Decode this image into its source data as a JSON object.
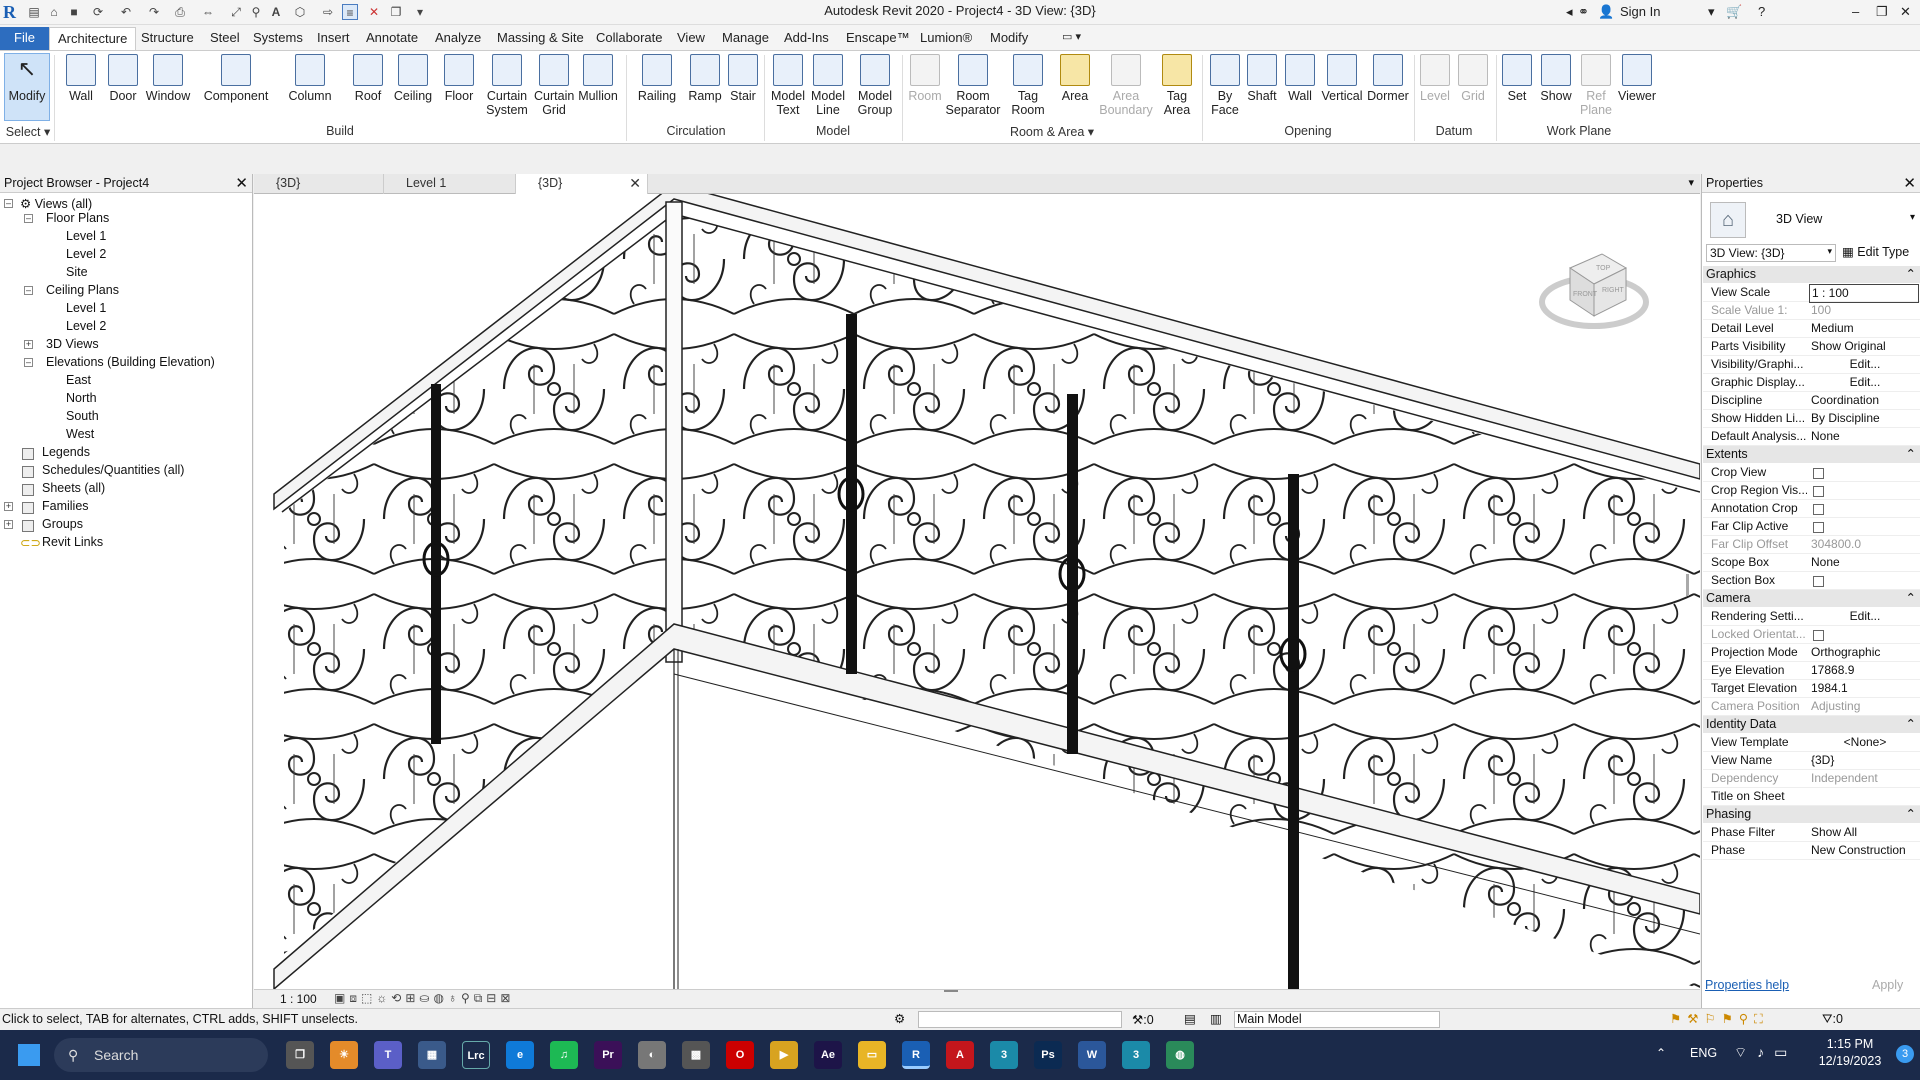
{
  "app": {
    "title": "Autodesk Revit 2020 - Project4 - 3D View: {3D}",
    "sign_in": "Sign In"
  },
  "ribbon_tabs": [
    "File",
    "Architecture",
    "Structure",
    "Steel",
    "Systems",
    "Insert",
    "Annotate",
    "Analyze",
    "Massing & Site",
    "Collaborate",
    "View",
    "Manage",
    "Add-Ins",
    "Enscape™",
    "Lumion®",
    "Modify"
  ],
  "ribbon": {
    "select_label": "Select",
    "modify": "Modify",
    "build": {
      "label": "Build",
      "buttons": [
        "Wall",
        "Door",
        "Window",
        "Component",
        "Column",
        "Roof",
        "Ceiling",
        "Floor",
        "Curtain System",
        "Curtain Grid",
        "Mullion"
      ]
    },
    "circulation": {
      "label": "Circulation",
      "buttons": [
        "Railing",
        "Ramp",
        "Stair"
      ]
    },
    "model": {
      "label": "Model",
      "buttons": [
        "Model Text",
        "Model Line",
        "Model Group"
      ]
    },
    "room_area": {
      "label": "Room & Area",
      "buttons": [
        "Room",
        "Room Separator",
        "Tag Room",
        "Area",
        "Area Boundary",
        "Tag Area"
      ]
    },
    "opening": {
      "label": "Opening",
      "buttons": [
        "By Face",
        "Shaft",
        "Wall",
        "Vertical",
        "Dormer"
      ]
    },
    "datum": {
      "label": "Datum",
      "buttons": [
        "Level",
        "Grid"
      ]
    },
    "work_plane": {
      "label": "Work Plane",
      "buttons": [
        "Set",
        "Show",
        "Ref Plane",
        "Viewer"
      ]
    }
  },
  "project_browser": {
    "title": "Project Browser - Project4",
    "tree": {
      "views": "Views (all)",
      "floor_plans": "Floor Plans",
      "fp_level1": "Level 1",
      "fp_level2": "Level 2",
      "fp_site": "Site",
      "ceiling_plans": "Ceiling Plans",
      "cp_level1": "Level 1",
      "cp_level2": "Level 2",
      "views_3d": "3D Views",
      "elevations": "Elevations (Building Elevation)",
      "east": "East",
      "north": "North",
      "south": "South",
      "west": "West",
      "legends": "Legends",
      "schedules": "Schedules/Quantities (all)",
      "sheets": "Sheets (all)",
      "families": "Families",
      "groups": "Groups",
      "revit_links": "Revit Links"
    }
  },
  "view_tabs": [
    "{3D}",
    "Level 1",
    "{3D}"
  ],
  "view_control": {
    "scale": "1 : 100"
  },
  "viewcube": {
    "top": "TOP",
    "front": "FRONT",
    "right": "RIGHT"
  },
  "properties": {
    "title": "Properties",
    "type_name": "3D View",
    "selector": "3D View: {3D}",
    "edit_type": "Edit Type",
    "help": "Properties help",
    "apply": "Apply",
    "groups": {
      "graphics": "Graphics",
      "extents": "Extents",
      "camera": "Camera",
      "identity": "Identity Data",
      "phasing": "Phasing"
    },
    "graphics_rows": [
      {
        "k": "View Scale",
        "v": "1 : 100"
      },
      {
        "k": "Scale Value    1:",
        "v": "100"
      },
      {
        "k": "Detail Level",
        "v": "Medium"
      },
      {
        "k": "Parts Visibility",
        "v": "Show Original"
      },
      {
        "k": "Visibility/Graphi...",
        "v": "Edit..."
      },
      {
        "k": "Graphic Display...",
        "v": "Edit..."
      },
      {
        "k": "Discipline",
        "v": "Coordination"
      },
      {
        "k": "Show Hidden Li...",
        "v": "By Discipline"
      },
      {
        "k": "Default Analysis...",
        "v": "None"
      }
    ],
    "extents_rows": [
      {
        "k": "Crop View",
        "v": ""
      },
      {
        "k": "Crop Region Vis...",
        "v": ""
      },
      {
        "k": "Annotation Crop",
        "v": ""
      },
      {
        "k": "Far Clip Active",
        "v": ""
      },
      {
        "k": "Far Clip Offset",
        "v": "304800.0"
      },
      {
        "k": "Scope Box",
        "v": "None"
      },
      {
        "k": "Section Box",
        "v": ""
      }
    ],
    "camera_rows": [
      {
        "k": "Rendering Setti...",
        "v": "Edit..."
      },
      {
        "k": "Locked Orientat...",
        "v": ""
      },
      {
        "k": "Projection Mode",
        "v": "Orthographic"
      },
      {
        "k": "Eye Elevation",
        "v": "17868.9"
      },
      {
        "k": "Target Elevation",
        "v": "1984.1"
      },
      {
        "k": "Camera Position",
        "v": "Adjusting"
      }
    ],
    "identity_rows": [
      {
        "k": "View Template",
        "v": "<None>"
      },
      {
        "k": "View Name",
        "v": "{3D}"
      },
      {
        "k": "Dependency",
        "v": "Independent"
      },
      {
        "k": "Title on Sheet",
        "v": ""
      }
    ],
    "phasing_rows": [
      {
        "k": "Phase Filter",
        "v": "Show All"
      },
      {
        "k": "Phase",
        "v": "New Construction"
      }
    ]
  },
  "status": {
    "hint": "Click to select, TAB for alternates, CTRL adds, SHIFT unselects.",
    "count": ":0",
    "model": "Main Model",
    "filter_count": ":0"
  },
  "taskbar": {
    "search": "Search",
    "lang": "ENG",
    "time": "1:15 PM",
    "date": "12/19/2023",
    "notif": "3"
  }
}
